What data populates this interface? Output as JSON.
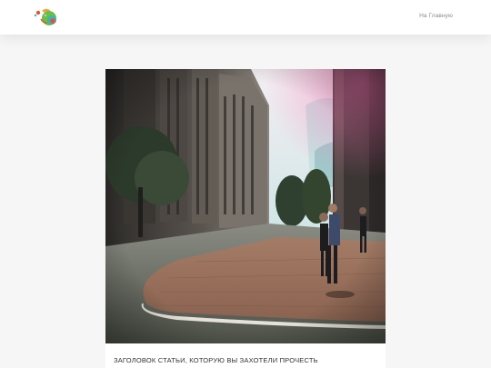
{
  "header": {
    "logo_icon": "chameleon-logo",
    "nav": {
      "home_label": "На Главную"
    }
  },
  "article": {
    "image_icon": "city-street-photo",
    "title": "ЗАГОЛОВОК СТАТЬИ, КОТОРУЮ ВЫ ЗАХОТЕЛИ ПРОЧЕСТЬ"
  },
  "colors": {
    "page_background": "#f6f6f6",
    "header_background": "#ffffff",
    "logo_green": "#6abf45",
    "logo_red": "#e8503e",
    "logo_teal": "#35b7b5",
    "nav_text": "#8a8a8a"
  }
}
